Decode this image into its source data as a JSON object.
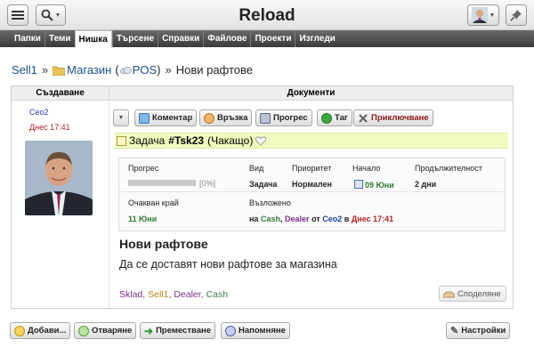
{
  "header": {
    "title": "Reload",
    "menu_icon": "hamburger-menu-icon",
    "search_icon": "magnifier-icon",
    "pin_icon": "pushpin-icon"
  },
  "nav": {
    "tabs": [
      {
        "label": "Папки",
        "active": false
      },
      {
        "label": "Теми",
        "active": false
      },
      {
        "label": "Нишка",
        "active": true
      },
      {
        "label": "Търсене",
        "active": false
      },
      {
        "label": "Справки",
        "active": false
      },
      {
        "label": "Файлове",
        "active": false
      },
      {
        "label": "Проекти",
        "active": false
      },
      {
        "label": "Изгледи",
        "active": false
      }
    ]
  },
  "breadcrumb": {
    "root": "Sell1",
    "sep1": "»",
    "folder": "Магазин",
    "paren_open": "(",
    "pos": "POS",
    "paren_close": ")",
    "sep2": "»",
    "current": "Нови рафтове"
  },
  "panel": {
    "col_created": "Създаване",
    "col_documents": "Документи",
    "creator": {
      "name": "Ceo2",
      "time": "Днес 17:41"
    }
  },
  "toolbar": {
    "comment": "Коментар",
    "link": "Връзка",
    "progress": "Прогрес",
    "tag": "Таг",
    "close": "Приключване"
  },
  "task": {
    "type_label": "Задача",
    "id": "#Tsk23",
    "status": "(Чакащо)",
    "title": "Нови рафтове",
    "description": "Да се доставят нови рафтове за магазина"
  },
  "details": {
    "progress_label": "Прогрес",
    "progress_value": "[0%]",
    "progress_fraction": 0,
    "type_label": "Вид",
    "type_value": "Задача",
    "priority_label": "Приоритет",
    "priority_value": "Нормален",
    "start_label": "Начало",
    "start_value": "09 Юни",
    "duration_label": "Продължителност",
    "duration_value": "2 дни",
    "expected_end_label": "Очакван край",
    "expected_end_value": "11 Юни",
    "assigned_label": "Възложено",
    "assigned_prefix": "на",
    "assignee1": "Cash",
    "comma": ",",
    "assignee2": "Dealer",
    "assigned_by": "от",
    "assigner": "Ceo2",
    "assigned_in": "в",
    "assigned_time": "Днес 17:41"
  },
  "tags": {
    "t1": "Sklad",
    "t2": "Sell1",
    "t3": "Dealer",
    "t4": "Cash",
    "comma": ","
  },
  "share_label": "Споделяне",
  "bottom": {
    "add": "Добави...",
    "open": "Отваряне",
    "move": "Преместване",
    "remind": "Напомняне",
    "settings": "Настройки"
  },
  "colors": {
    "nav_bg": "#4a4a4a",
    "task_bar_bg": "#f1fbbf",
    "link_blue": "#1a4f8b",
    "date_red": "#b22222",
    "progress_green": "#7ca23a"
  }
}
